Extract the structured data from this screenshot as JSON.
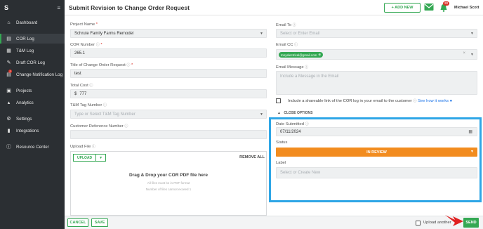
{
  "app": {
    "logo": "S",
    "page_title": "Submit Revision to Change Order Request"
  },
  "sidebar": {
    "items": [
      {
        "label": "Dashboard",
        "icon": "home-icon"
      },
      {
        "label": "COR Log",
        "icon": "document-icon",
        "active": true
      },
      {
        "label": "T&M Log",
        "icon": "grid-icon"
      },
      {
        "label": "Draft COR Log",
        "icon": "edit-icon"
      },
      {
        "label": "Change Notification Log",
        "icon": "alert-log-icon",
        "badge": "2"
      },
      {
        "label": "Projects",
        "icon": "briefcase-icon"
      },
      {
        "label": "Analytics",
        "icon": "chart-icon"
      },
      {
        "label": "Settings",
        "icon": "gear-icon"
      },
      {
        "label": "Integrations",
        "icon": "plug-icon"
      },
      {
        "label": "Resource Center",
        "icon": "help-icon"
      }
    ]
  },
  "header": {
    "add_new": "+ ADD NEW",
    "notification_count": "28",
    "user_name": "Michael Scott"
  },
  "form": {
    "project_name": {
      "label": "Project Name",
      "value": "Schrute Family Farms Remodel"
    },
    "cor_number": {
      "label": "COR Number",
      "value": "265.1"
    },
    "title": {
      "label": "Title of Change Order Request",
      "value": "test"
    },
    "total_cost": {
      "label": "Total Cost",
      "currency": "$",
      "value": "777"
    },
    "tm_tag": {
      "label": "T&M Tag Number",
      "placeholder": "Type or Select T&M Tag Number"
    },
    "customer_ref": {
      "label": "Customer Reference Number",
      "value": ""
    },
    "upload": {
      "label": "Upload File",
      "button": "UPLOAD",
      "remove_all": "REMOVE ALL",
      "drop_title": "Drag & Drop your COR PDF file here",
      "drop_sub1": "All files must be in PDF format",
      "drop_sub2": "Number of files cannot exceed 1"
    },
    "email_to": {
      "label": "Email To",
      "placeholder": "Select or Enter Email"
    },
    "email_cc": {
      "label": "Email CC",
      "chip": "tonyelectrical@gmail.com"
    },
    "email_message": {
      "label": "Email Message",
      "placeholder": "Include a Message in the Email"
    },
    "shareable": {
      "label": "Include a shareable link of the COR log in your email to the customer",
      "link": "See how it works"
    },
    "close_options": "CLOSE OPTIONS",
    "date_submitted": {
      "label": "Date Submitted",
      "value": "07/11/2024"
    },
    "status": {
      "label": "Status",
      "value": "IN REVIEW"
    },
    "label_field": {
      "label": "Label",
      "placeholder": "Select or Create New"
    }
  },
  "footer": {
    "cancel": "CANCEL",
    "save": "SAVE",
    "upload_another": "Upload another",
    "send": "SEND"
  },
  "colors": {
    "accent": "#34a853",
    "status": "#f28c1f",
    "highlight": "#2ea6e6",
    "sidebar": "#2b2f33"
  }
}
